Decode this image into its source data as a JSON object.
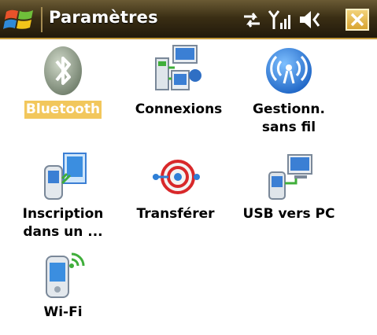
{
  "titlebar": {
    "title": "Paramètres",
    "icons": [
      "windows-start-icon",
      "data-connection-icon",
      "signal-strength-icon",
      "volume-icon",
      "close-icon"
    ]
  },
  "items": [
    {
      "label": "Bluetooth",
      "icon": "bluetooth-icon",
      "selected": true
    },
    {
      "label": "Connexions",
      "icon": "connections-icon",
      "selected": false
    },
    {
      "label": "Gestionn.\nsans fil",
      "icon": "wireless-manager-icon",
      "selected": false
    },
    {
      "label": "Inscription\ndans un ...",
      "icon": "enrollment-icon",
      "selected": false
    },
    {
      "label": "Transférer",
      "icon": "beam-transfer-icon",
      "selected": false
    },
    {
      "label": "USB vers PC",
      "icon": "usb-to-pc-icon",
      "selected": false
    },
    {
      "label": "Wi-Fi",
      "icon": "wifi-icon",
      "selected": false
    }
  ],
  "colors": {
    "titlebar": "#2b2110",
    "selection": "#f2c75c",
    "accent_blue": "#2f7fd6"
  }
}
